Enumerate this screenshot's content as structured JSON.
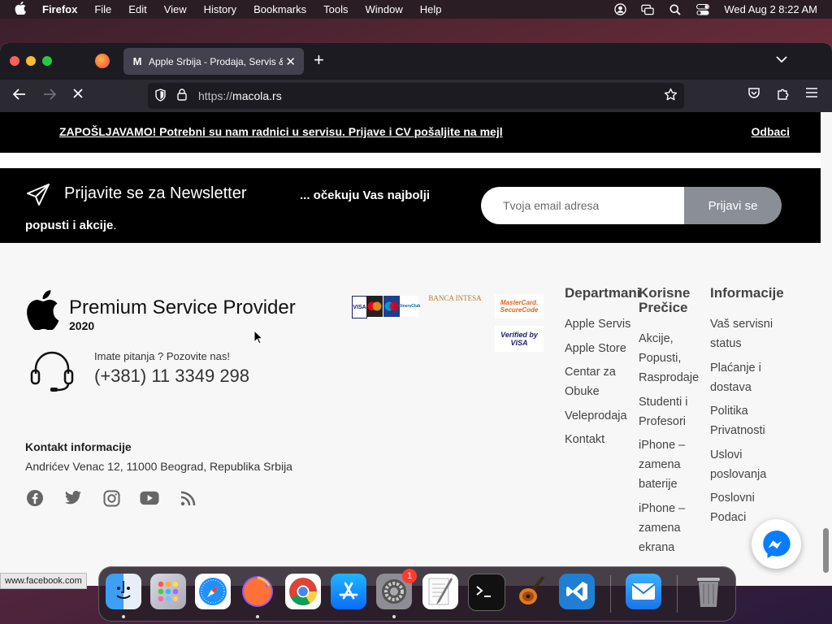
{
  "menubar": {
    "app": "Firefox",
    "items": [
      "File",
      "Edit",
      "View",
      "History",
      "Bookmarks",
      "Tools",
      "Window",
      "Help"
    ],
    "clock": "Wed Aug 2  8:22 AM"
  },
  "browser": {
    "tab_title": "Apple Srbija - Prodaja, Servis & ...",
    "url_proto": "https://",
    "url_host": "macola.rs"
  },
  "notice": {
    "message": "ZAPOŠLJAVAMO! Potrebni su nam radnici u servisu. Prijave i CV pošaljite na mejl",
    "dismiss": "Odbaci"
  },
  "newsletter": {
    "heading": "Prijavite se za Newsletter",
    "sub_prefix": "... očekuju Vas ",
    "sub_bold": "najbolji",
    "sub_line2": "popusti i akcije",
    "sub_dot": ".",
    "placeholder": "Tvoja email adresa",
    "button": "Prijavi se"
  },
  "footer": {
    "brand_title": "Premium Service Provider",
    "brand_year": "2020",
    "call_label": "Imate pitanja ? Pozovite nas!",
    "phone": "(+381) 11 3349 298",
    "contact_title": "Kontakt informacije",
    "contact_address": "Andrićev Venac 12, 11000 Beograd, Republika Srbija",
    "cards": {
      "visa": "VISA",
      "bank": "BANCA INTESA",
      "mastercard": "MasterCard. SecureCode",
      "verified": "Verified by VISA",
      "diners": "DinersClub"
    },
    "columns": {
      "departmani": {
        "title": "Departmani",
        "links": [
          "Apple Servis",
          "Apple Store",
          "Centar za",
          "Obuke",
          "Veleprodaja",
          "Kontakt"
        ]
      },
      "korisne": {
        "title1": "Korisne",
        "title2": "Prečice",
        "links": [
          "Akcije,",
          "Popusti,",
          "Rasprodaje",
          "Studenti i",
          "Profesori",
          "iPhone –",
          "zamena",
          "baterije",
          "iPhone –",
          "zamena",
          "ekrana"
        ]
      },
      "informacije": {
        "title": "Informacije",
        "links": [
          "Vaš servisni",
          "status",
          "Plaćanje i",
          "dostava",
          "Politika",
          "Privatnosti",
          "Uslovi",
          "poslovanja",
          "Poslovni",
          "Podaci"
        ]
      }
    }
  },
  "status_url": "www.facebook.com",
  "dock": {
    "settings_badge": "1"
  }
}
